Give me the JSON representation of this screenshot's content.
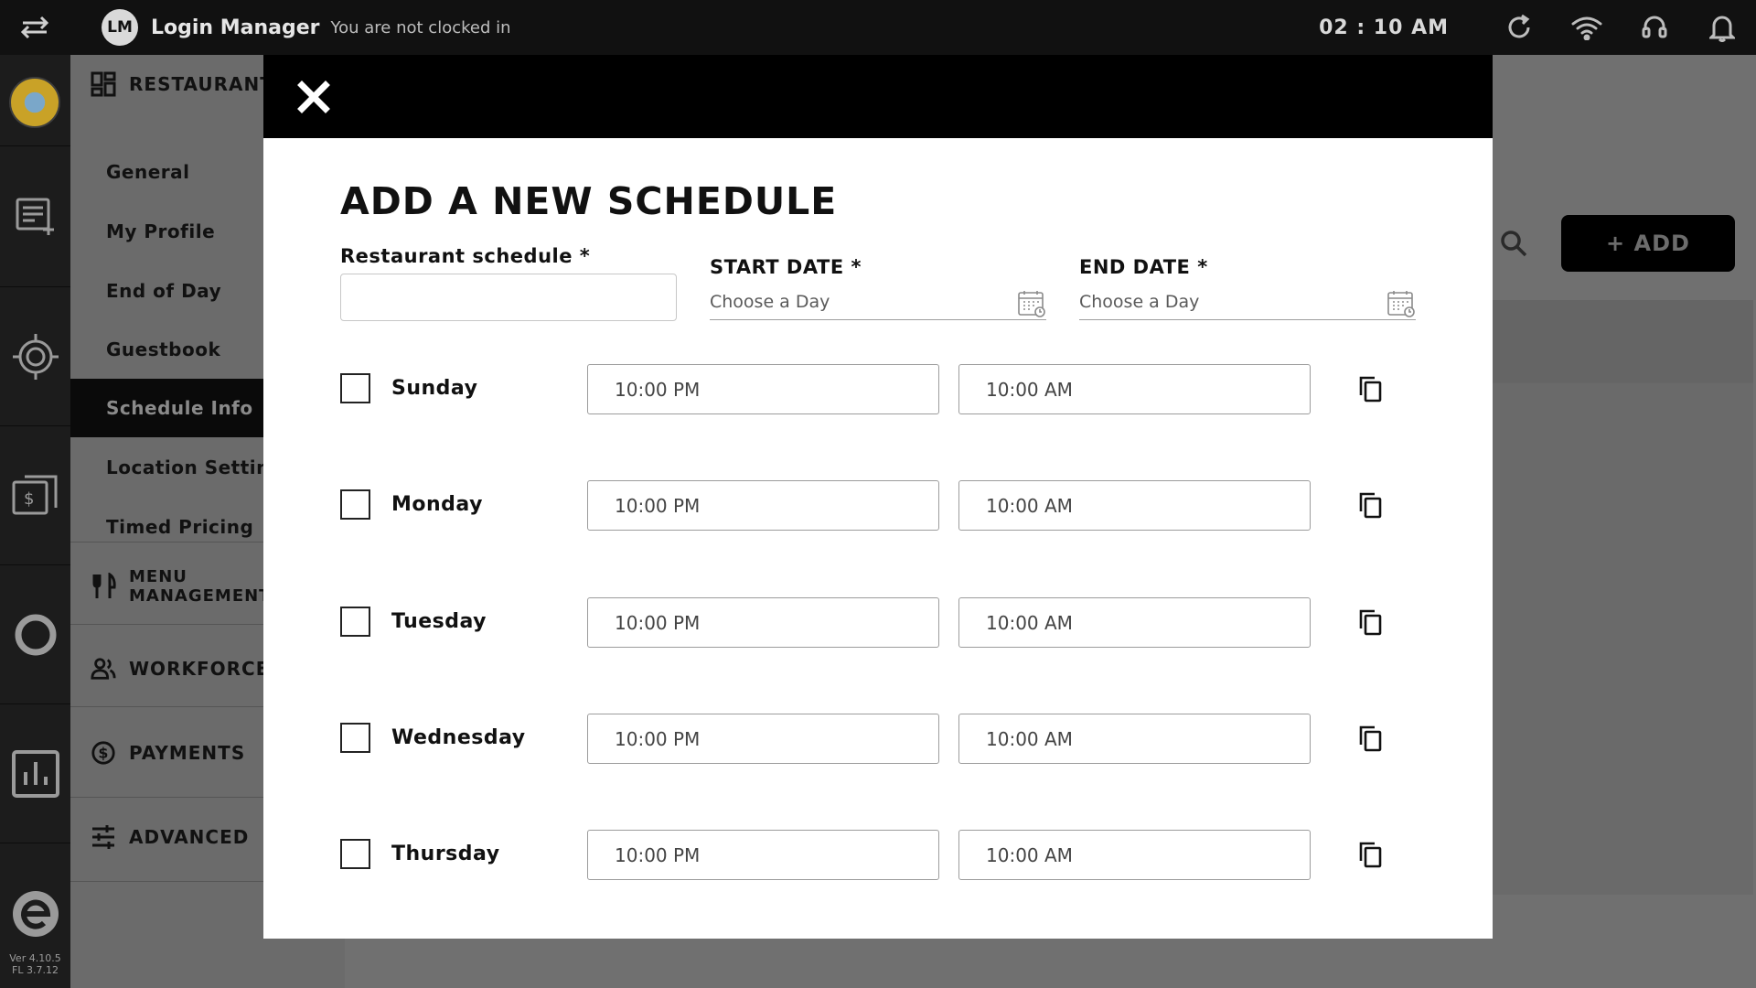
{
  "topbar": {
    "app_badge": "LM",
    "app_title": "Login Manager",
    "clock_status": "You are not clocked in",
    "time": "02 : 10 AM",
    "icons": [
      "swap-arrows-icon",
      "refresh-icon",
      "wifi-icon",
      "headset-icon",
      "bell-icon"
    ]
  },
  "rail": {
    "items": [
      "restaurant-logo",
      "order-list-icon",
      "kitchen-display-icon",
      "cash-register-icon",
      "sync-circle-icon",
      "reports-chart-icon",
      "brand-e-logo"
    ],
    "version_line1": "Ver 4.10.5",
    "version_line2": "FL 3.7.12"
  },
  "sidenav": {
    "section_restaurant": "RESTAURANT",
    "items": [
      {
        "label": "General"
      },
      {
        "label": "My Profile"
      },
      {
        "label": "End of Day"
      },
      {
        "label": "Guestbook"
      },
      {
        "label": "Schedule Info"
      },
      {
        "label": "Location Setting"
      },
      {
        "label": "Timed Pricing"
      }
    ],
    "active_item": "Schedule Info",
    "section_menu_line1": "MENU",
    "section_menu_line2": "MANAGEMENT",
    "section_workforce": "WORKFORCE",
    "section_payments": "PAYMENTS",
    "section_advanced": "ADVANCED"
  },
  "content": {
    "add_button": "+ ADD"
  },
  "modal": {
    "title": "ADD A NEW SCHEDULE",
    "schedule_label": "Restaurant schedule *",
    "schedule_value": "",
    "start_date_label": "START DATE *",
    "start_date_placeholder": "Choose a Day",
    "end_date_label": "END DATE *",
    "end_date_placeholder": "Choose a Day",
    "days": [
      {
        "name": "Sunday",
        "start": "10:00 PM",
        "end": "10:00 AM",
        "checked": false
      },
      {
        "name": "Monday",
        "start": "10:00 PM",
        "end": "10:00 AM",
        "checked": false
      },
      {
        "name": "Tuesday",
        "start": "10:00 PM",
        "end": "10:00 AM",
        "checked": false
      },
      {
        "name": "Wednesday",
        "start": "10:00 PM",
        "end": "10:00 AM",
        "checked": false
      },
      {
        "name": "Thursday",
        "start": "10:00 PM",
        "end": "10:00 AM",
        "checked": false
      }
    ]
  }
}
